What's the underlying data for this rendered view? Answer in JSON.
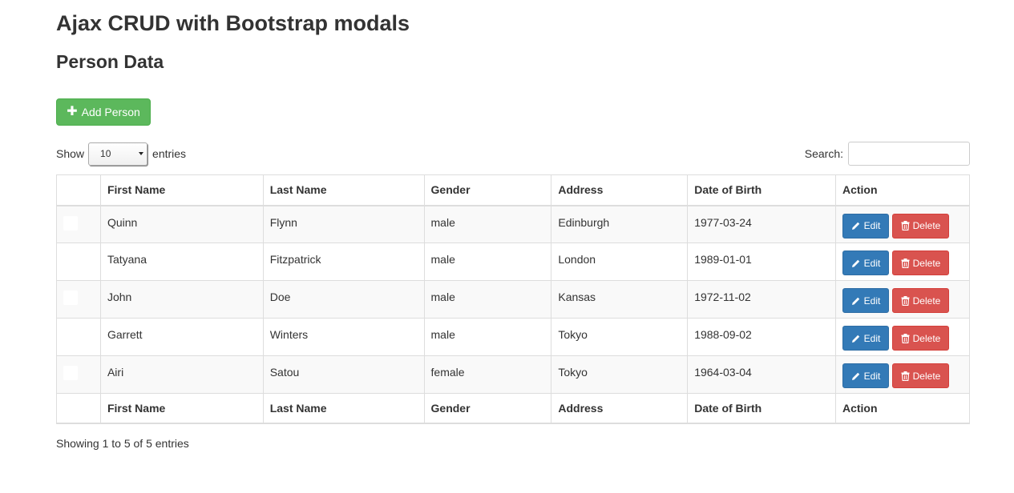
{
  "header": {
    "title": "Ajax CRUD with Bootstrap modals",
    "section_title": "Person Data"
  },
  "toolbar": {
    "add_label": "Add Person",
    "add_icon": "plus-icon",
    "add_color": "#5cb85c"
  },
  "length": {
    "show_label": "Show",
    "selected": "10",
    "entries_label": "entries"
  },
  "search": {
    "label": "Search:",
    "value": ""
  },
  "table": {
    "columns": [
      "",
      "First Name",
      "Last Name",
      "Gender",
      "Address",
      "Date of Birth",
      "Action"
    ],
    "rows": [
      {
        "first": "Quinn",
        "last": "Flynn",
        "gender": "male",
        "address": "Edinburgh",
        "dob": "1977-03-24",
        "edit": "Edit",
        "delete": "Delete"
      },
      {
        "first": "Tatyana",
        "last": "Fitzpatrick",
        "gender": "male",
        "address": "London",
        "dob": "1989-01-01",
        "edit": "Edit",
        "delete": "Delete"
      },
      {
        "first": "John",
        "last": "Doe",
        "gender": "male",
        "address": "Kansas",
        "dob": "1972-11-02",
        "edit": "Edit",
        "delete": "Delete"
      },
      {
        "first": "Garrett",
        "last": "Winters",
        "gender": "male",
        "address": "Tokyo",
        "dob": "1988-09-02",
        "edit": "Edit",
        "delete": "Delete"
      },
      {
        "first": "Airi",
        "last": "Satou",
        "gender": "female",
        "address": "Tokyo",
        "dob": "1964-03-04",
        "edit": "Edit",
        "delete": "Delete"
      }
    ],
    "edit_icon": "pencil-icon",
    "delete_icon": "trash-icon",
    "edit_color": "#337ab7",
    "delete_color": "#d9534f"
  },
  "footer": {
    "info": "Showing 1 to 5 of 5 entries"
  }
}
